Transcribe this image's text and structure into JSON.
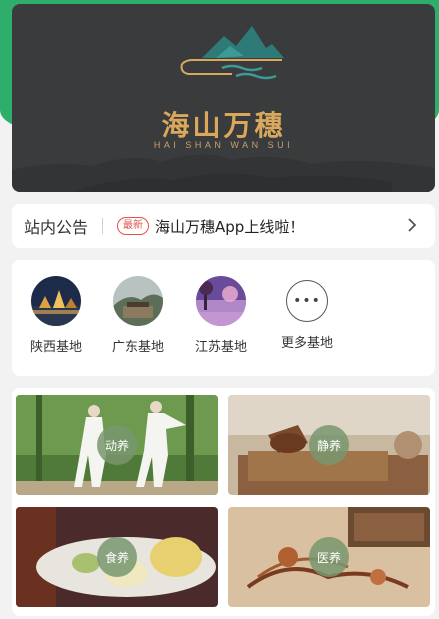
{
  "banner": {
    "brand_cn": "海山万穗",
    "brand_en": "HAI SHAN WAN SUI"
  },
  "notice": {
    "title": "站内公告",
    "badge": "最新",
    "text": "海山万穗App上线啦！"
  },
  "bases": {
    "items": [
      {
        "label": "陕西基地"
      },
      {
        "label": "广东基地"
      },
      {
        "label": "江苏基地"
      },
      {
        "label": "更多基地",
        "icon": "more-dots-icon"
      }
    ]
  },
  "categories": {
    "items": [
      {
        "label": "动养"
      },
      {
        "label": "静养"
      },
      {
        "label": "食养"
      },
      {
        "label": "医养"
      }
    ]
  },
  "colors": {
    "accent_green": "#2fae6b",
    "brand_gold": "#d9a85d",
    "badge_red": "#e0524a"
  }
}
